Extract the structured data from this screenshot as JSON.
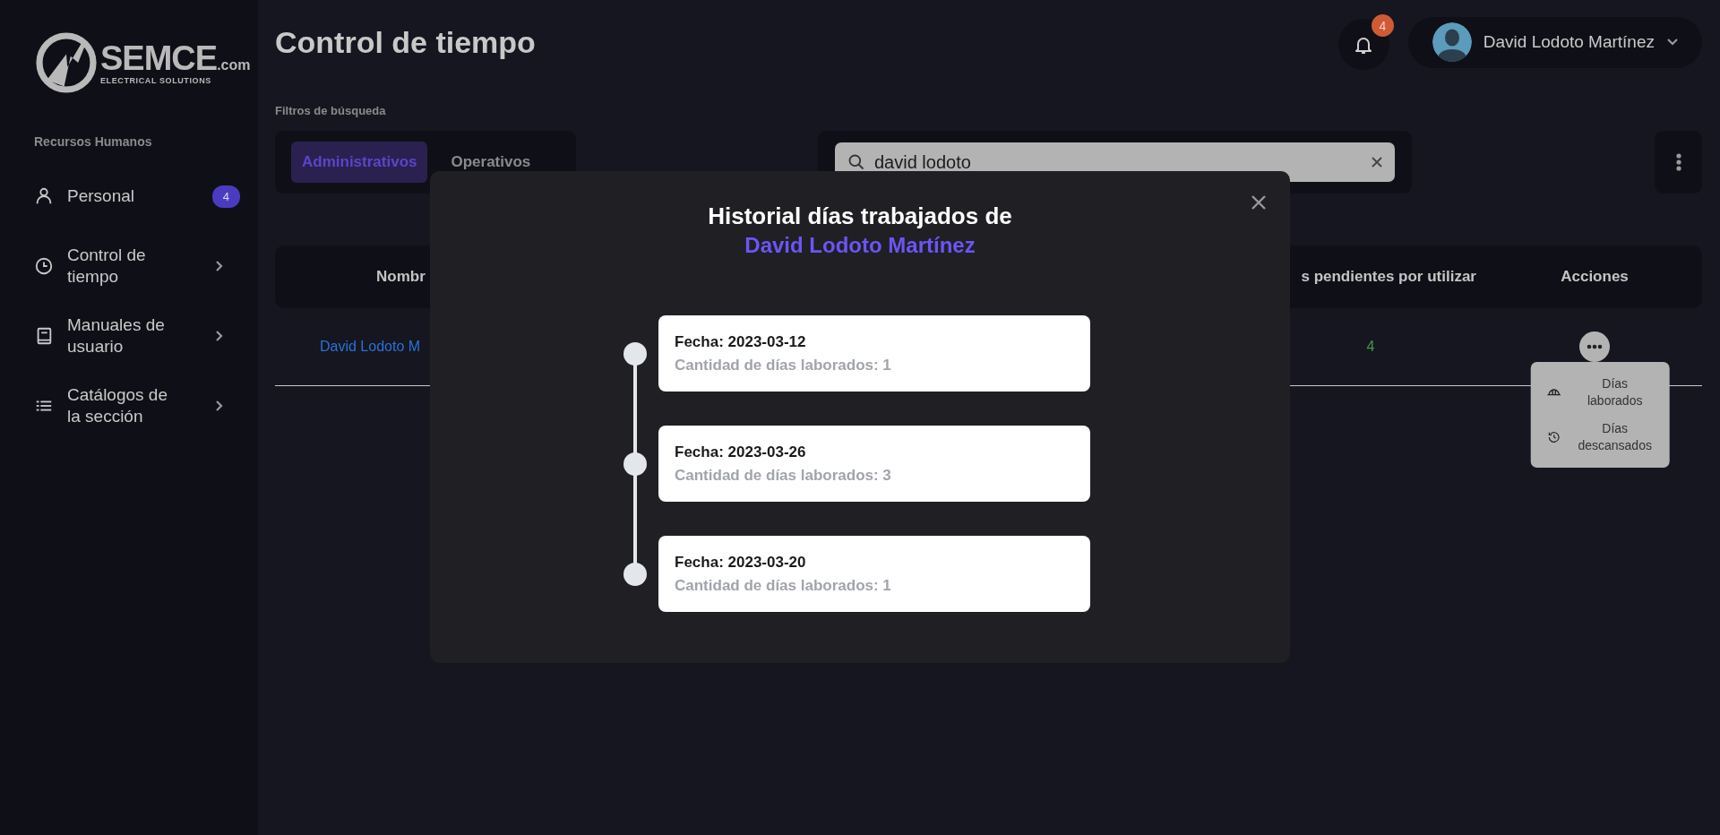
{
  "logo": {
    "name": "SEMCE",
    "suffix": ".com",
    "tagline": "ELECTRICAL SOLUTIONS"
  },
  "sidebar": {
    "section": "Recursos Humanos",
    "items": [
      {
        "label": "Personal",
        "kind": "link",
        "badge": "4"
      },
      {
        "label": "Control de tiempo",
        "kind": "group"
      },
      {
        "label": "Manuales de usuario",
        "kind": "group"
      },
      {
        "label": "Catálogos de la sección",
        "kind": "group"
      }
    ]
  },
  "header": {
    "title": "Control de tiempo",
    "notifications": "4",
    "user": "David Lodoto Martínez"
  },
  "filters": {
    "label": "Filtros de búsqueda",
    "tabs": [
      {
        "label": "Administrativos",
        "selected": true
      },
      {
        "label": "Operativos",
        "selected": false
      }
    ],
    "search": {
      "value": "david lodoto"
    }
  },
  "table": {
    "columns": [
      "Nombr",
      "s pendientes por utilizar",
      "Acciones"
    ],
    "rows": [
      {
        "cells": [
          "David Lodoto M",
          "4"
        ],
        "menu_open": true
      }
    ],
    "action_menu": [
      "Días laborados",
      "Días descansados"
    ]
  },
  "modal": {
    "title": "Historial días trabajados de",
    "subject": "David Lodoto Martínez",
    "entries": [
      {
        "date": "Fecha: 2023-03-12",
        "count": "Cantidad de días laborados: 1"
      },
      {
        "date": "Fecha: 2023-03-26",
        "count": "Cantidad de días laborados: 3"
      },
      {
        "date": "Fecha: 2023-03-20",
        "count": "Cantidad de días laborados: 1"
      }
    ]
  }
}
